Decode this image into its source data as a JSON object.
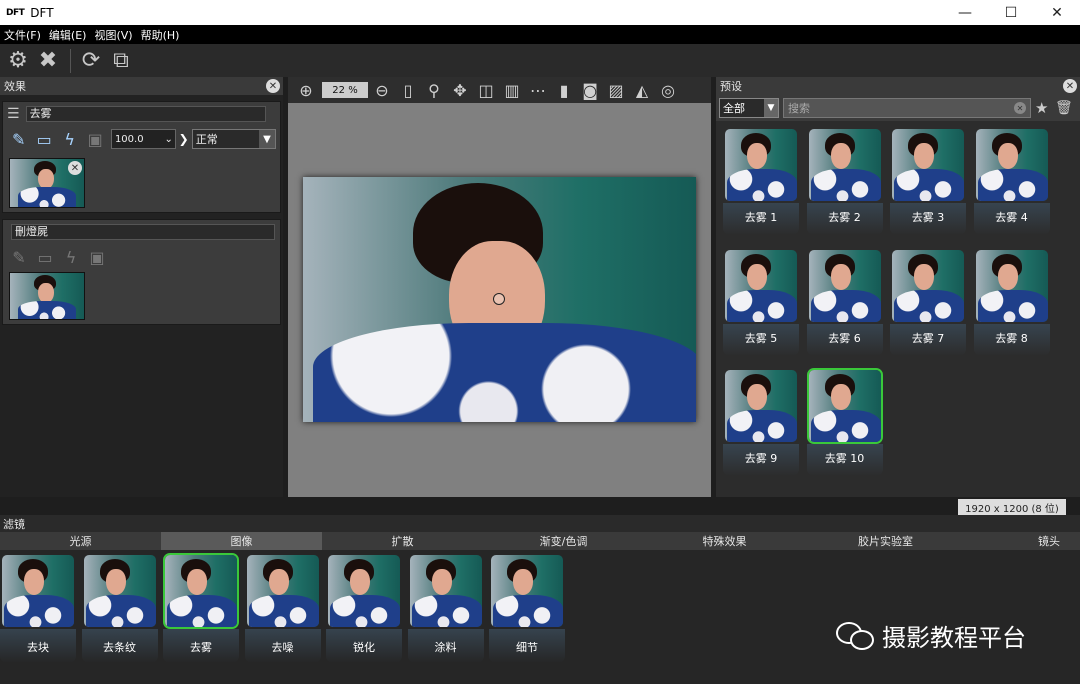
{
  "window": {
    "logo": "DFT",
    "title": "DFT",
    "min": "—",
    "max": "☐",
    "close": "✕"
  },
  "menu": [
    "文件(F)",
    "编辑(E)",
    "视图(V)",
    "帮助(H)"
  ],
  "effects": {
    "title": "效果",
    "layer1": {
      "name": "去雾",
      "opacity": "100.0",
      "mode": "正常"
    },
    "layer2": {
      "name": "刪燈屍"
    }
  },
  "canvas": {
    "zoom": "22 %",
    "resolution": "1920 x 1200 (8 位)"
  },
  "presets": {
    "title": "预设",
    "filter": "全部",
    "search_placeholder": "搜索",
    "items": [
      "去雾 1",
      "去雾 2",
      "去雾 3",
      "去雾 4",
      "去雾 5",
      "去雾 6",
      "去雾 7",
      "去雾 8",
      "去雾 9",
      "去雾 10"
    ],
    "selected": "去雾 10"
  },
  "filters": {
    "title": "滤镜",
    "tabs": [
      "光源",
      "图像",
      "扩散",
      "渐变/色调",
      "特殊效果",
      "胶片实验室",
      "镜头"
    ],
    "active_tab": "图像",
    "items": [
      "去块",
      "去条纹",
      "去雾",
      "去噪",
      "锐化",
      "涂料",
      "细节"
    ],
    "selected": "去雾"
  },
  "watermark": "摄影教程平台",
  "colors": {
    "accent_selected": "#3ac83a",
    "tool_icon_blue": "#a8d4ff"
  }
}
